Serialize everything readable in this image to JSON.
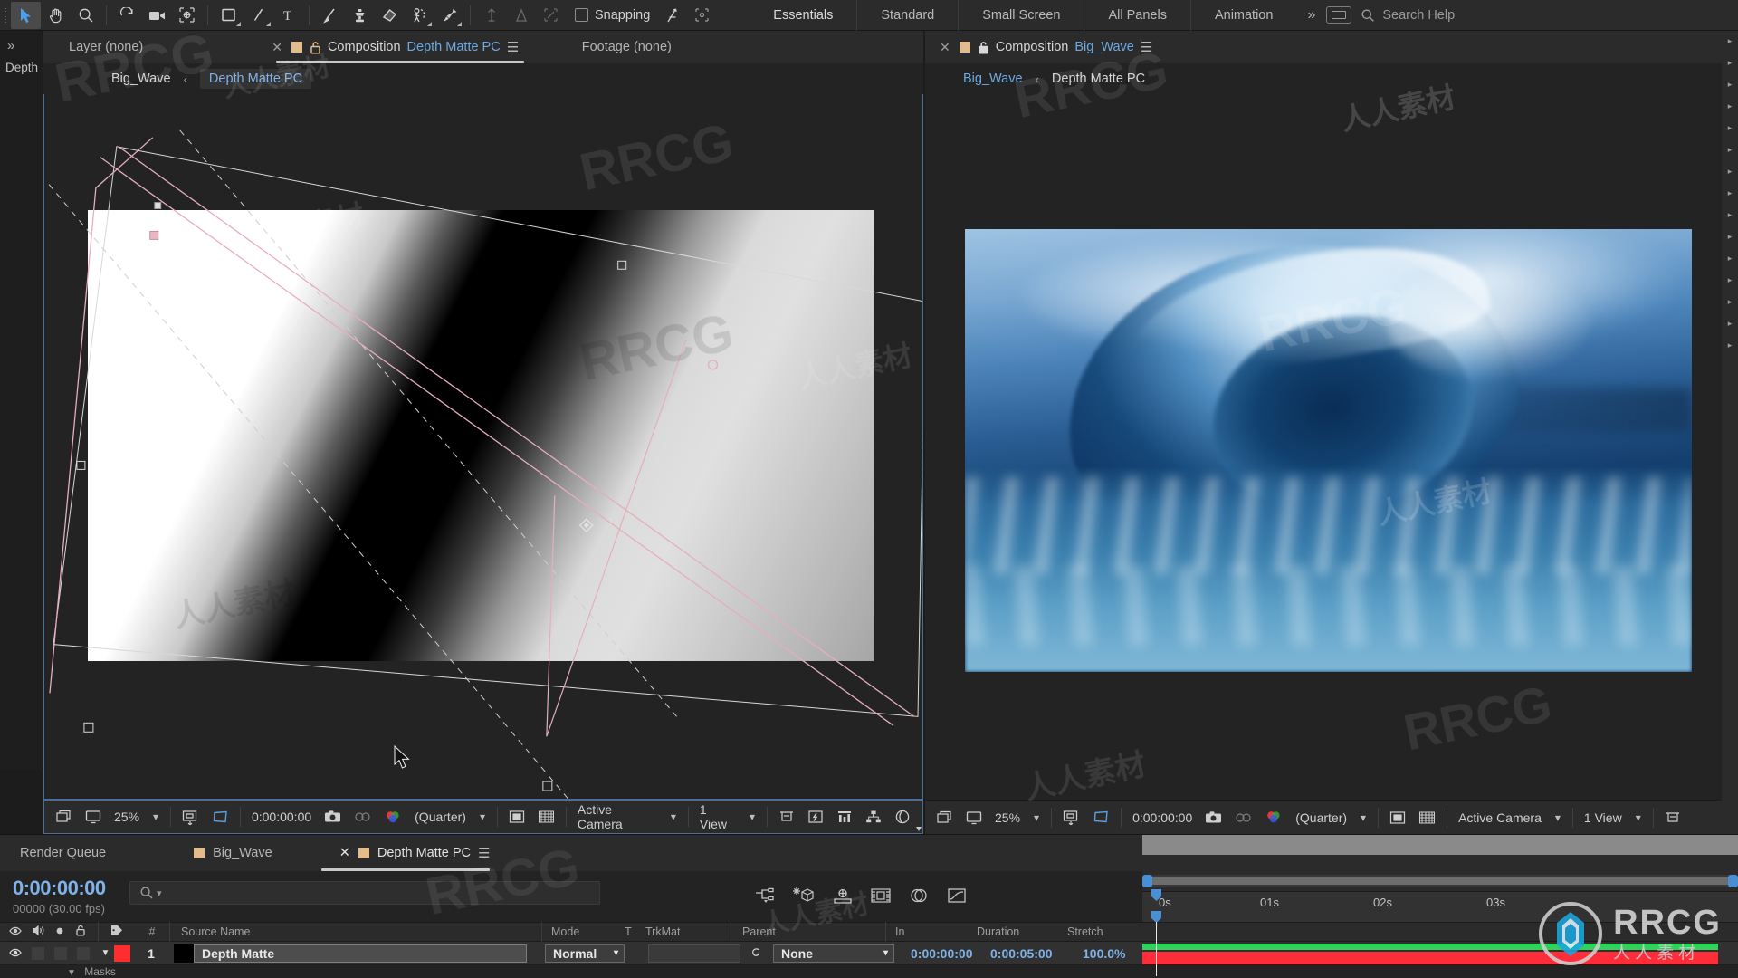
{
  "app": {
    "name": "Adobe After Effects"
  },
  "toolbar": {
    "tools": [
      {
        "name": "selection-tool",
        "label": "Selection",
        "selected": true
      },
      {
        "name": "hand-tool",
        "label": "Hand",
        "selected": false
      },
      {
        "name": "zoom-tool",
        "label": "Zoom",
        "selected": false
      },
      {
        "name": "rotation-tool",
        "label": "Rotation",
        "selected": false
      },
      {
        "name": "camera-tool",
        "label": "Unified Camera",
        "selected": false
      },
      {
        "name": "pan-behind-tool",
        "label": "Pan Behind (Anchor Point)",
        "selected": false
      },
      {
        "name": "rectangle-tool",
        "label": "Rectangle",
        "selected": false
      },
      {
        "name": "pen-tool",
        "label": "Pen",
        "selected": false
      },
      {
        "name": "type-tool",
        "label": "Horizontal Type",
        "selected": false
      },
      {
        "name": "brush-tool",
        "label": "Brush",
        "selected": false
      },
      {
        "name": "clone-stamp-tool",
        "label": "Clone Stamp",
        "selected": false
      },
      {
        "name": "eraser-tool",
        "label": "Eraser",
        "selected": false
      },
      {
        "name": "roto-brush-tool",
        "label": "Roto Brush",
        "selected": false
      },
      {
        "name": "puppet-pin-tool",
        "label": "Puppet Pin",
        "selected": false
      }
    ],
    "dimmed_tools": [
      {
        "name": "puppet-starch-tool",
        "label": "Puppet Starch"
      },
      {
        "name": "puppet-advanced-pin-tool",
        "label": "Puppet Advanced Pin"
      },
      {
        "name": "puppet-overlap-tool",
        "label": "Puppet Overlap"
      }
    ],
    "snapping_label": "Snapping",
    "snapping_checked": false,
    "workspaces": [
      "Essentials",
      "Standard",
      "Small Screen",
      "All Panels",
      "Animation"
    ],
    "workspace_active": "Essentials",
    "workspace_overflow": "»",
    "search_help_placeholder": "Search Help"
  },
  "left_rail": {
    "chevron": "»",
    "label": "Depth"
  },
  "comp_left": {
    "tabs": [
      {
        "name": "layer-tab",
        "label": "Layer (none)",
        "selected": false
      },
      {
        "name": "composition-tab",
        "prefix": "Composition",
        "title": "Depth Matte PC",
        "selected": true
      },
      {
        "name": "footage-tab",
        "label": "Footage (none)",
        "selected": false
      }
    ],
    "breadcrumb": {
      "root": "Big_Wave",
      "arrow": "‹",
      "current": "Depth Matte PC"
    },
    "bottom_bar": {
      "zoom": "25%",
      "timecode": "0:00:00:00",
      "resolution": "(Quarter)",
      "camera": "Active Camera",
      "views": "1 View",
      "icons": [
        "always-preview-icon",
        "monitor-icon",
        "region-of-interest-icon",
        "transparency-grid-icon",
        "take-snapshot-icon",
        "show-snapshot-icon",
        "channel-icon",
        "mask-icon",
        "toggle-grid-icon",
        "fast-previews-icon",
        "timeline-icon",
        "comp-flowchart-icon",
        "reset-exposure-icon"
      ]
    }
  },
  "comp_right": {
    "tabs": [
      {
        "name": "composition-tab",
        "prefix": "Composition",
        "title": "Big_Wave",
        "selected": true
      }
    ],
    "breadcrumb": {
      "root": "Big_Wave",
      "arrow": "‹",
      "current": "Depth Matte PC"
    },
    "bottom_bar": {
      "zoom": "25%",
      "timecode": "0:00:00:00",
      "resolution": "(Quarter)",
      "camera": "Active Camera",
      "views": "1 View"
    }
  },
  "timeline": {
    "tabs": [
      {
        "name": "render-queue-tab",
        "label": "Render Queue",
        "selected": false,
        "swatch": false
      },
      {
        "name": "big-wave-tab",
        "label": "Big_Wave",
        "selected": false,
        "swatch": true
      },
      {
        "name": "depth-matte-pc-tab",
        "label": "Depth Matte PC",
        "selected": true,
        "swatch": true
      }
    ],
    "current_time": "0:00:00:00",
    "frame_info": "00000 (30.00 fps)",
    "search_placeholder": "",
    "switch_icons": [
      "composition-mini-flowchart-icon",
      "draft-3d-icon",
      "hide-shy-layers-icon",
      "frame-blending-icon",
      "motion-blur-icon",
      "graph-editor-icon"
    ],
    "columns": [
      "#",
      "Source Name",
      "Mode",
      "T",
      "TrkMat",
      "Parent",
      "In",
      "Duration",
      "Stretch"
    ],
    "av_header_icons": [
      "eye-icon",
      "audio-icon",
      "solo-icon",
      "lock-icon",
      "label-icon"
    ],
    "rows": [
      {
        "index": "1",
        "source_name": "Depth Matte",
        "label_color": "#ff2d2d",
        "mode": "Normal",
        "trkmat": "",
        "parent": "None",
        "in": "0:00:00:00",
        "duration": "0:00:05:00",
        "stretch": "100.0%"
      }
    ],
    "sub_row_label": "Masks",
    "ruler_ticks": [
      "0s",
      "01s",
      "02s",
      "03s"
    ]
  },
  "watermarks": {
    "latin": "RRCG",
    "chinese": "人人素材",
    "logo_text": "RRCG",
    "logo_sub": "人人素材"
  },
  "colors": {
    "accent_blue": "#7fb2e8",
    "panel_bg": "#232323",
    "toolbar_bg": "#2b2b2b",
    "layer_label_red": "#ff2d2d",
    "work_area_green": "#2fd35a",
    "render_bar_red": "#ff2d3a"
  }
}
